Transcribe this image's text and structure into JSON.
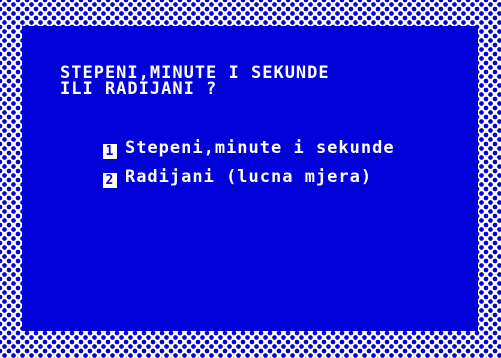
{
  "question": {
    "line1": "STEPENI,MINUTE I SEKUNDE",
    "line2": "ILI RADIJANI ?"
  },
  "options": [
    {
      "key": "1",
      "label": "Stepeni,minute i sekunde"
    },
    {
      "key": "2",
      "label": "Radijani (lucna mjera)"
    }
  ],
  "colors": {
    "screen_blue": "#0000d8",
    "text": "#ffffff",
    "border_pattern": "#ffffff"
  }
}
